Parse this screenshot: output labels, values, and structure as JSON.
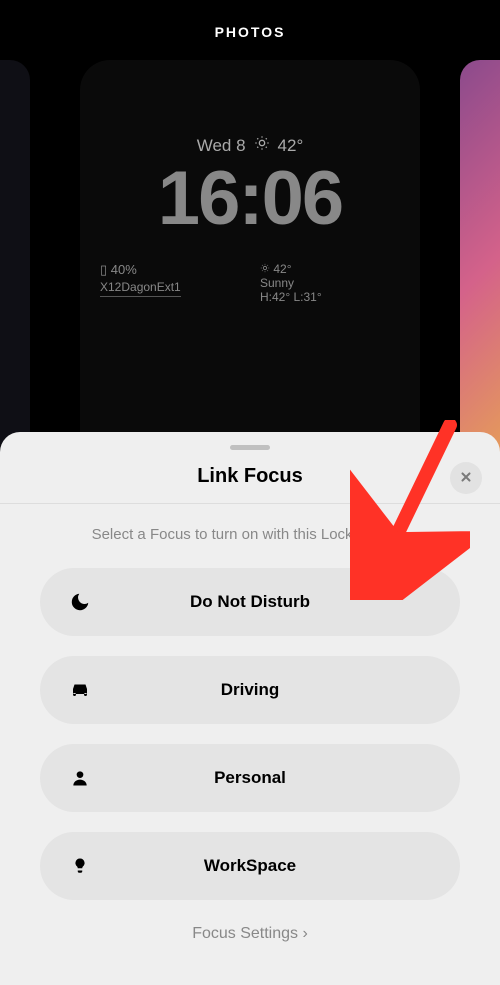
{
  "header": {
    "title": "PHOTOS"
  },
  "preview": {
    "date_day": "Wed 8",
    "date_temp": "42°",
    "time": "16:06",
    "battery": "40%",
    "wifi": "X12DagonExt1",
    "weather_temp": "42°",
    "weather_cond": "Sunny",
    "weather_hilo": "H:42° L:31°"
  },
  "sheet": {
    "title": "Link Focus",
    "subtitle": "Select a Focus to turn on with this Lock Screen.",
    "items": [
      {
        "icon": "moon",
        "label": "Do Not Disturb"
      },
      {
        "icon": "car",
        "label": "Driving"
      },
      {
        "icon": "person",
        "label": "Personal"
      },
      {
        "icon": "bulb",
        "label": "WorkSpace"
      }
    ],
    "settings": "Focus Settings"
  }
}
